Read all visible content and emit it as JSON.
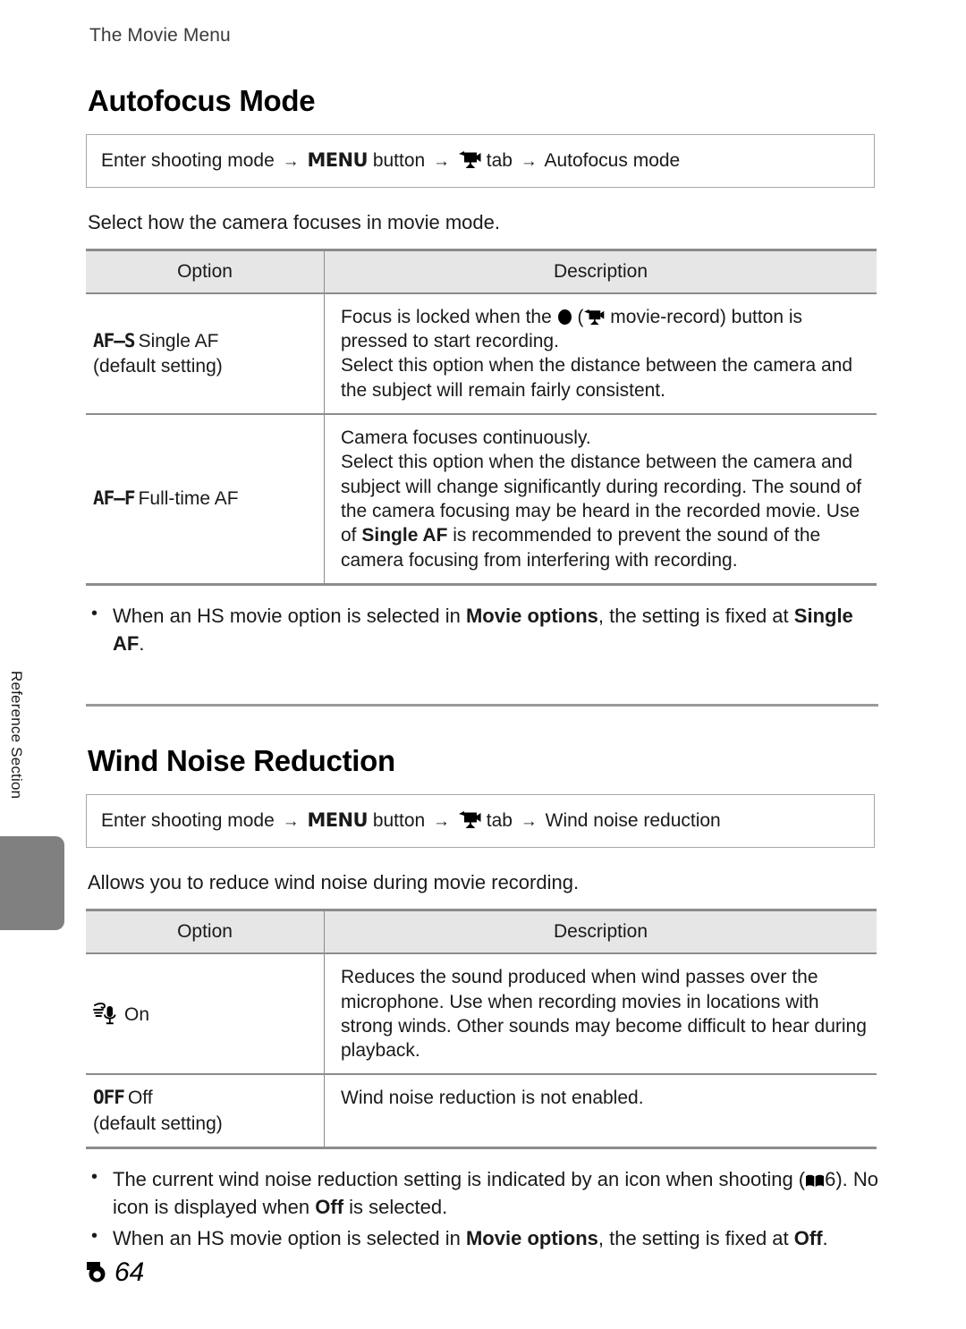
{
  "page": {
    "running_head": "The Movie Menu",
    "footer_page": "64",
    "sidebar_label": "Reference Section"
  },
  "sections": [
    {
      "id": "autofocus-mode",
      "title": "Autofocus Mode",
      "nav_path": {
        "prefix": "Enter shooting mode",
        "menu_label": "MENU",
        "button_word": "button",
        "tab_word": "tab",
        "target": "Autofocus mode",
        "arrow": "→"
      },
      "intro": "Select how the camera focuses in movie mode.",
      "table": {
        "headers": [
          "Option",
          "Description"
        ],
        "rows": [
          {
            "code": "AF–S",
            "name": "Single AF",
            "default_note": "(default setting)",
            "description_parts": [
              {
                "text": "Focus is locked when the "
              },
              {
                "icon": "record-dot-icon"
              },
              {
                "text": " ("
              },
              {
                "icon": "movie-camera-icon"
              },
              {
                "text": " movie-record) button is pressed to start recording."
              },
              {
                "break": true
              },
              {
                "text": "Select this option when the distance between the camera and the subject will remain fairly consistent."
              }
            ]
          },
          {
            "code": "AF–F",
            "name": "Full-time AF",
            "default_note": "",
            "description_parts": [
              {
                "text": "Camera focuses continuously."
              },
              {
                "break": true
              },
              {
                "text": "Select this option when the distance between the camera and subject will change significantly during recording. The sound of the camera focusing may be heard in the recorded movie. Use of "
              },
              {
                "text": "Single AF",
                "bold": true
              },
              {
                "text": " is recommended to prevent the sound of the camera focusing from interfering with recording."
              }
            ]
          }
        ]
      },
      "notes": [
        [
          {
            "text": "When an HS movie option is selected in "
          },
          {
            "text": "Movie options",
            "bold": true
          },
          {
            "text": ", the setting is fixed at "
          },
          {
            "text": "Single AF",
            "bold": true
          },
          {
            "text": "."
          }
        ]
      ]
    },
    {
      "id": "wind-noise-reduction",
      "title": "Wind Noise Reduction",
      "nav_path": {
        "prefix": "Enter shooting mode",
        "menu_label": "MENU",
        "button_word": "button",
        "tab_word": "tab",
        "target": "Wind noise reduction",
        "arrow": "→"
      },
      "intro": "Allows you to reduce wind noise during movie recording.",
      "table": {
        "headers": [
          "Option",
          "Description"
        ],
        "rows": [
          {
            "icon": "wind-mic-icon",
            "name": "On",
            "default_note": "",
            "description_parts": [
              {
                "text": "Reduces the sound produced when wind passes over the microphone. Use when recording movies in locations with strong winds. Other sounds may become difficult to hear during playback."
              }
            ]
          },
          {
            "code": "OFF",
            "name": "Off",
            "default_note": "(default setting)",
            "description_parts": [
              {
                "text": "Wind noise reduction is not enabled."
              }
            ]
          }
        ]
      },
      "notes": [
        [
          {
            "text": "The current wind noise reduction setting is indicated by an icon when shooting ("
          },
          {
            "icon": "open-book-icon"
          },
          {
            "text": "6). No icon is displayed when "
          },
          {
            "text": "Off",
            "bold": true
          },
          {
            "text": " is selected."
          }
        ],
        [
          {
            "text": "When an HS movie option is selected in "
          },
          {
            "text": "Movie options",
            "bold": true
          },
          {
            "text": ", the setting is fixed at "
          },
          {
            "text": "Off",
            "bold": true
          },
          {
            "text": "."
          }
        ]
      ]
    }
  ],
  "colors": {
    "text": "#1a1a1a",
    "rule": "#8c8c8c",
    "table_header_bg": "#e6e6e6",
    "sidebar_tab": "#808080",
    "box_border": "#a6a6a6"
  }
}
